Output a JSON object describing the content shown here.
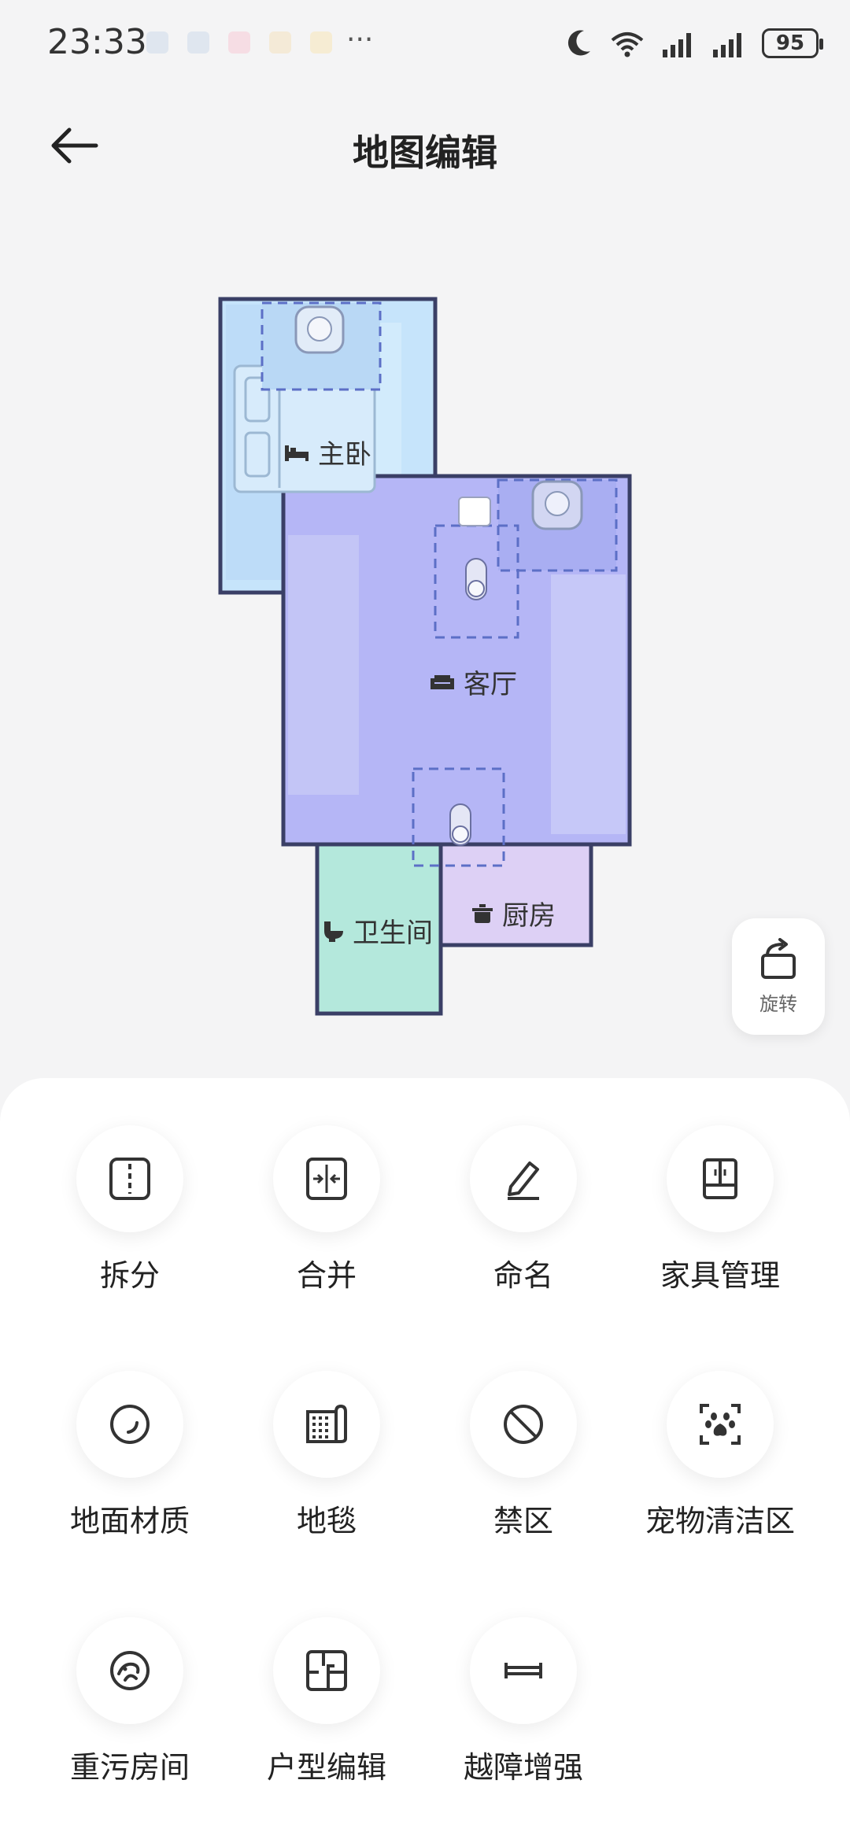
{
  "status": {
    "time": "23:33",
    "battery": "95",
    "network": "6"
  },
  "header": {
    "title": "地图编辑"
  },
  "rooms": {
    "master": "主卧",
    "living": "客厅",
    "bath": "卫生间",
    "kitchen": "厨房"
  },
  "rotate": {
    "label": "旋转"
  },
  "tools": [
    {
      "label": "拆分",
      "icon": "split-icon"
    },
    {
      "label": "合并",
      "icon": "merge-icon"
    },
    {
      "label": "命名",
      "icon": "pen-icon"
    },
    {
      "label": "家具管理",
      "icon": "furniture-icon"
    },
    {
      "label": "地面材质",
      "icon": "floor-material-icon"
    },
    {
      "label": "地毯",
      "icon": "carpet-icon"
    },
    {
      "label": "禁区",
      "icon": "no-go-icon"
    },
    {
      "label": "宠物清洁区",
      "icon": "paw-icon"
    },
    {
      "label": "重污房间",
      "icon": "heavy-dirt-icon"
    },
    {
      "label": "户型编辑",
      "icon": "floorplan-edit-icon"
    },
    {
      "label": "越障增强",
      "icon": "obstacle-icon"
    }
  ],
  "colors": {
    "bedroom": "#c6e4fb",
    "living": "#b5b6f6",
    "bath": "#b4e8dc",
    "kitchen": "#ddd0f5",
    "wall": "#3a3f66"
  }
}
